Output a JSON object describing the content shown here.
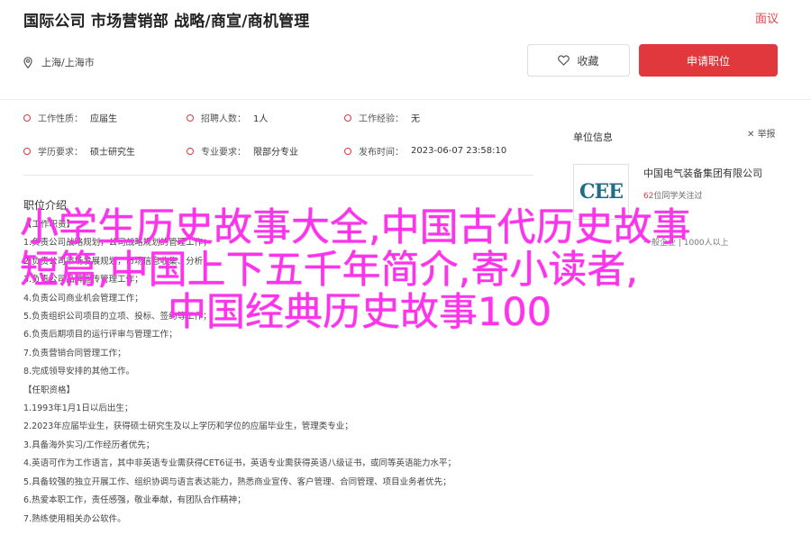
{
  "header": {
    "job_title": "国际公司 市场营销部 战略/商宣/商机管理",
    "report": "面议",
    "location": "上海/上海市",
    "favorite_label": "收藏",
    "apply_label": "申请职位"
  },
  "attributes": [
    {
      "key": "工作性质：",
      "value": "应届生"
    },
    {
      "key": "招聘人数：",
      "value": "1人"
    },
    {
      "key": "工作经验：",
      "value": "无"
    },
    {
      "key": "学历要求：",
      "value": "硕士研究生"
    },
    {
      "key": "专业要求：",
      "value": "限部分专业"
    },
    {
      "key": "发布时间：",
      "value": "2023-06-07 23:58:10"
    }
  ],
  "description": {
    "title": "职位介绍",
    "lines": [
      "【工作职责】",
      "1.负责公司战略规划，公司战略规划的管理工作；",
      "2.负责公司市场发展规划，市场信息收集、分析；",
      "3.负责公司品牌宣传管理工作；",
      "4.负责公司商业机会管理工作；",
      "5.负责组织公司项目的立项、投标、签约等工作；",
      "6.负责后期项目的运行评审与管理工作；",
      "7.负责营销合同管理工作；",
      "8.完成领导安排的其他工作。",
      "【任职资格】",
      "1.1993年1月1日以后出生；",
      "2.2023年应届毕业生，获得硕士研究生及以上学历和学位的应届毕业生，管理类专业；",
      "3.具备海外实习/工作经历者优先；",
      "4.英语可作为工作语言，其中非英语专业需获得CET6证书，英语专业需获得英语八级证书，或同等英语能力水平；",
      "5.具备较强的独立开展工作、组织协调与语言表达能力，熟悉商业宣传、客户管理、合同管理、项目业务者优先；",
      "6.热爱本职工作，责任感强，敬业奉献，有团队合作精神；",
      "7.熟练使用相关办公软件。"
    ]
  },
  "sidebar": {
    "title": "单位信息",
    "report_label": "举报",
    "logo_text": "CEE",
    "company_name": "中国电气装备集团有限公司",
    "rating_score": "62",
    "rating_suffix": "位同学关注过",
    "truncated_text": "一般企业 | 1000人以上"
  },
  "overlay": {
    "line1": "小学生历史故事大全,中国古代历史故事",
    "line2": "短篇,中国上下五千年简介,寄小读者,",
    "line3": "中国经典历史故事100"
  },
  "colors": {
    "accent": "#e1383e",
    "overlay_text": "#ff33ee",
    "logo": "#1d6e86"
  }
}
